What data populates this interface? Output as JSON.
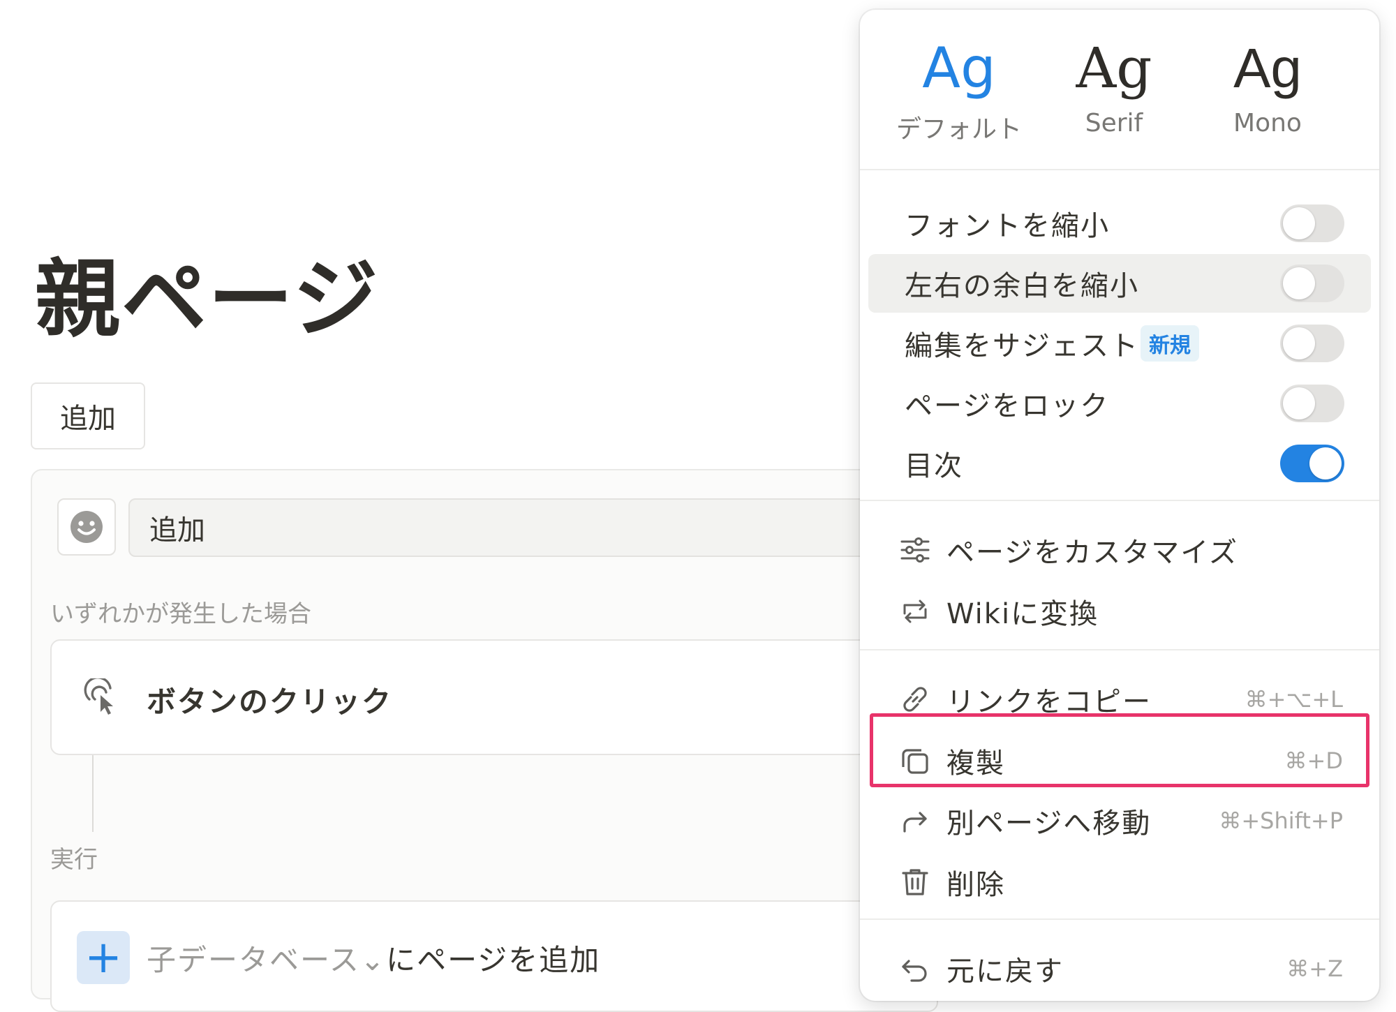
{
  "page": {
    "title": "親ページ",
    "add_button_label": "追加"
  },
  "automation": {
    "name_value": "追加",
    "trigger_section_label": "いずれかが発生した場合",
    "trigger_label": "ボタンのクリック",
    "action_section_label": "実行",
    "action_prefix": "子データベース",
    "action_dropdown_glyph": "⌄",
    "action_suffix": "にページを追加",
    "action_plus_glyph": "+"
  },
  "menu": {
    "fonts": [
      {
        "sample": "Ag",
        "name": "デフォルト",
        "selected": true
      },
      {
        "sample": "Ag",
        "name": "Serif",
        "selected": false
      },
      {
        "sample": "Ag",
        "name": "Mono",
        "selected": false
      }
    ],
    "toggles": [
      {
        "label": "フォントを縮小",
        "on": false
      },
      {
        "label": "左右の余白を縮小",
        "on": false
      },
      {
        "label": "編集をサジェスト",
        "badge": "新規",
        "on": false
      },
      {
        "label": "ページをロック",
        "on": false
      },
      {
        "label": "目次",
        "on": true
      }
    ],
    "actions": [
      {
        "label": "ページをカスタマイズ",
        "icon": "sliders-icon"
      },
      {
        "label": "Wikiに変換",
        "icon": "convert-icon"
      }
    ],
    "page_actions": [
      {
        "label": "リンクをコピー",
        "shortcut": "⌘+⌥+L",
        "icon": "link-icon"
      },
      {
        "label": "複製",
        "shortcut": "⌘+D",
        "icon": "duplicate-icon",
        "highlighted": true
      },
      {
        "label": "別ページへ移動",
        "shortcut": "⌘+Shift+P",
        "icon": "move-arrow-icon"
      },
      {
        "label": "削除",
        "icon": "trash-icon"
      },
      {
        "label": "元に戻す",
        "shortcut": "⌘+Z",
        "icon": "undo-icon"
      }
    ]
  },
  "colors": {
    "accent": "#2383e2",
    "highlight_border": "#e8336a",
    "toggle_off": "#e3e2e0"
  }
}
